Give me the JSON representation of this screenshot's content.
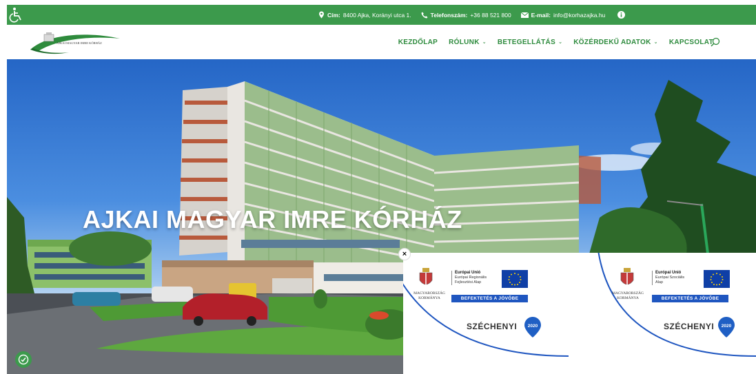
{
  "topbar": {
    "address_label": "Cím:",
    "address_value": "8400 Ajka, Korányi utca 1.",
    "phone_label": "Telefonszám:",
    "phone_value": "+36 88 521 800",
    "email_label": "E-mail:",
    "email_value": "info@korhazajka.hu",
    "icons": [
      "accessibility-icon",
      "location-pin-icon",
      "phone-icon",
      "envelope-icon",
      "info-icon"
    ],
    "bg_color": "#3c9a4c"
  },
  "header": {
    "logo_text": "AJKAI MAGYAR IMRE KÓRHÁZ",
    "nav": [
      {
        "label": "KEZDŐLAP",
        "dropdown": false
      },
      {
        "label": "RÓLUNK",
        "dropdown": true
      },
      {
        "label": "BETEGELLÁTÁS",
        "dropdown": true
      },
      {
        "label": "KÖZÉRDEKŰ ADATOK",
        "dropdown": true
      },
      {
        "label": "KAPCSOLAT",
        "dropdown": false
      }
    ],
    "chevron": "⌄",
    "accent_color": "#2c8a3c"
  },
  "hero": {
    "title": "AJKAI MAGYAR IMRE KÓRHÁZ"
  },
  "eu_popup": {
    "close_label": "×",
    "cards": [
      {
        "country": "MAGYARORSZÁG KORMÁNYA",
        "eu_title": "Európai Unió",
        "fund_line1": "Európai Regionális",
        "fund_line2": "Fejlesztési Alap",
        "invest_label": "BEFEKTETÉS A JÖVŐBE",
        "program": "SZÉCHENYI",
        "year": "2020"
      },
      {
        "country": "MAGYARORSZÁG KORMÁNYA",
        "eu_title": "Európai Unió",
        "fund_line1": "Európai Szociális",
        "fund_line2": "Alap",
        "invest_label": "BEFEKTETÉS A JÖVŐBE",
        "program": "SZÉCHENYI",
        "year": "2020"
      }
    ]
  }
}
